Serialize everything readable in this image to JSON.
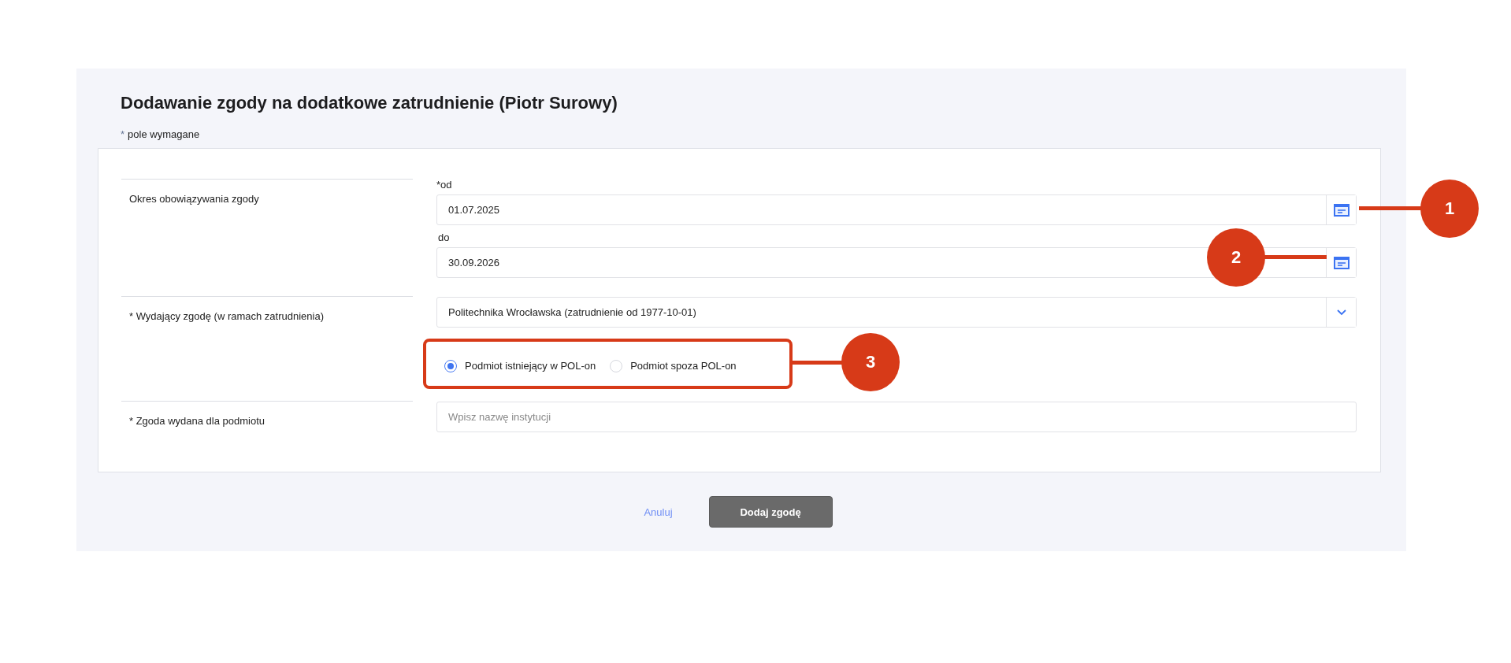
{
  "title": "Dodawanie zgody na dodatkowe zatrudnienie (Piotr Surowy)",
  "required_note": {
    "mark": "*",
    "text": "pole wymagane"
  },
  "sections": [
    {
      "kind": "date_range",
      "label": "Okres obowiązywania zgody",
      "fields": [
        {
          "label": "*od",
          "value": "01.07.2025"
        },
        {
          "label": "do",
          "value": "30.09.2026"
        }
      ]
    },
    {
      "kind": "select",
      "label": "* Wydający zgodę (w ramach zatrudnienia)",
      "value": "Politechnika Wrocławska (zatrudnienie od 1977-10-01)",
      "options": [
        {
          "label": "Podmiot istniejący w POL-on",
          "selected": true
        },
        {
          "label": "Podmiot spoza POL-on",
          "selected": false
        }
      ]
    },
    {
      "kind": "text",
      "label": "* Zgoda wydana dla podmiotu",
      "placeholder": "Wpisz nazwę instytucji"
    }
  ],
  "actions": {
    "cancel": "Anuluj",
    "submit": "Dodaj zgodę"
  },
  "callouts": [
    {
      "number": "1"
    },
    {
      "number": "2"
    },
    {
      "number": "3"
    }
  ]
}
